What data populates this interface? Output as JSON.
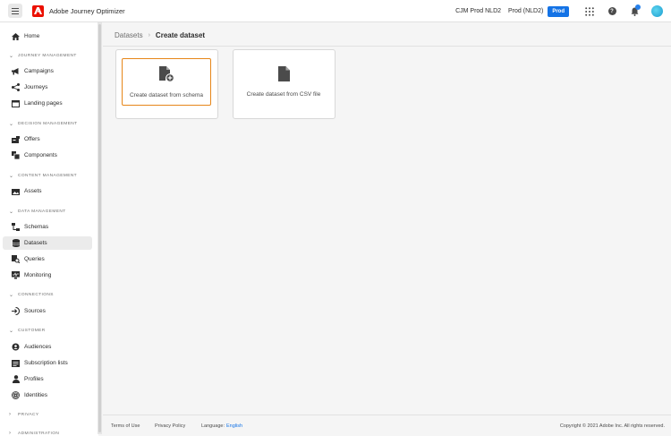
{
  "header": {
    "app_name": "Adobe Journey Optimizer",
    "org": "CJM Prod NLD2",
    "sandbox": "Prod (NLD2)",
    "badge": "Prod",
    "icons": [
      "menu-icon",
      "apps-grid-icon",
      "help-icon",
      "bell-icon",
      "avatar"
    ]
  },
  "sidebar": {
    "home": "Home",
    "sections": {
      "journey": "JOURNEY MANAGEMENT",
      "decision": "DECISION MANAGEMENT",
      "content": "CONTENT MANAGEMENT",
      "data": "DATA MANAGEMENT",
      "connections": "CONNECTIONS",
      "customer": "CUSTOMER",
      "privacy": "PRIVACY",
      "administration": "ADMINISTRATION"
    },
    "items": {
      "campaigns": "Campaigns",
      "journeys": "Journeys",
      "landing_pages": "Landing pages",
      "offers": "Offers",
      "components": "Components",
      "assets": "Assets",
      "schemas": "Schemas",
      "datasets": "Datasets",
      "queries": "Queries",
      "monitoring": "Monitoring",
      "sources": "Sources",
      "audiences": "Audiences",
      "subscription_lists": "Subscription lists",
      "profiles": "Profiles",
      "identities": "Identities"
    },
    "active": "Datasets"
  },
  "breadcrumb": {
    "parent": "Datasets",
    "separator": "›",
    "current": "Create dataset"
  },
  "cards": [
    {
      "label": "Create dataset from schema",
      "icon": "document-add-icon",
      "selected": true
    },
    {
      "label": "Create dataset from CSV file",
      "icon": "document-icon",
      "selected": false
    }
  ],
  "footer": {
    "terms": "Terms of Use",
    "privacy": "Privacy Policy",
    "language_label": "Language:",
    "language_value": "English",
    "copyright": "Copyright © 2021 Adobe Inc. All rights reserved."
  },
  "colors": {
    "accent": "#1473e6",
    "selected_border": "#e68619",
    "adobe_red": "#eb1000"
  }
}
